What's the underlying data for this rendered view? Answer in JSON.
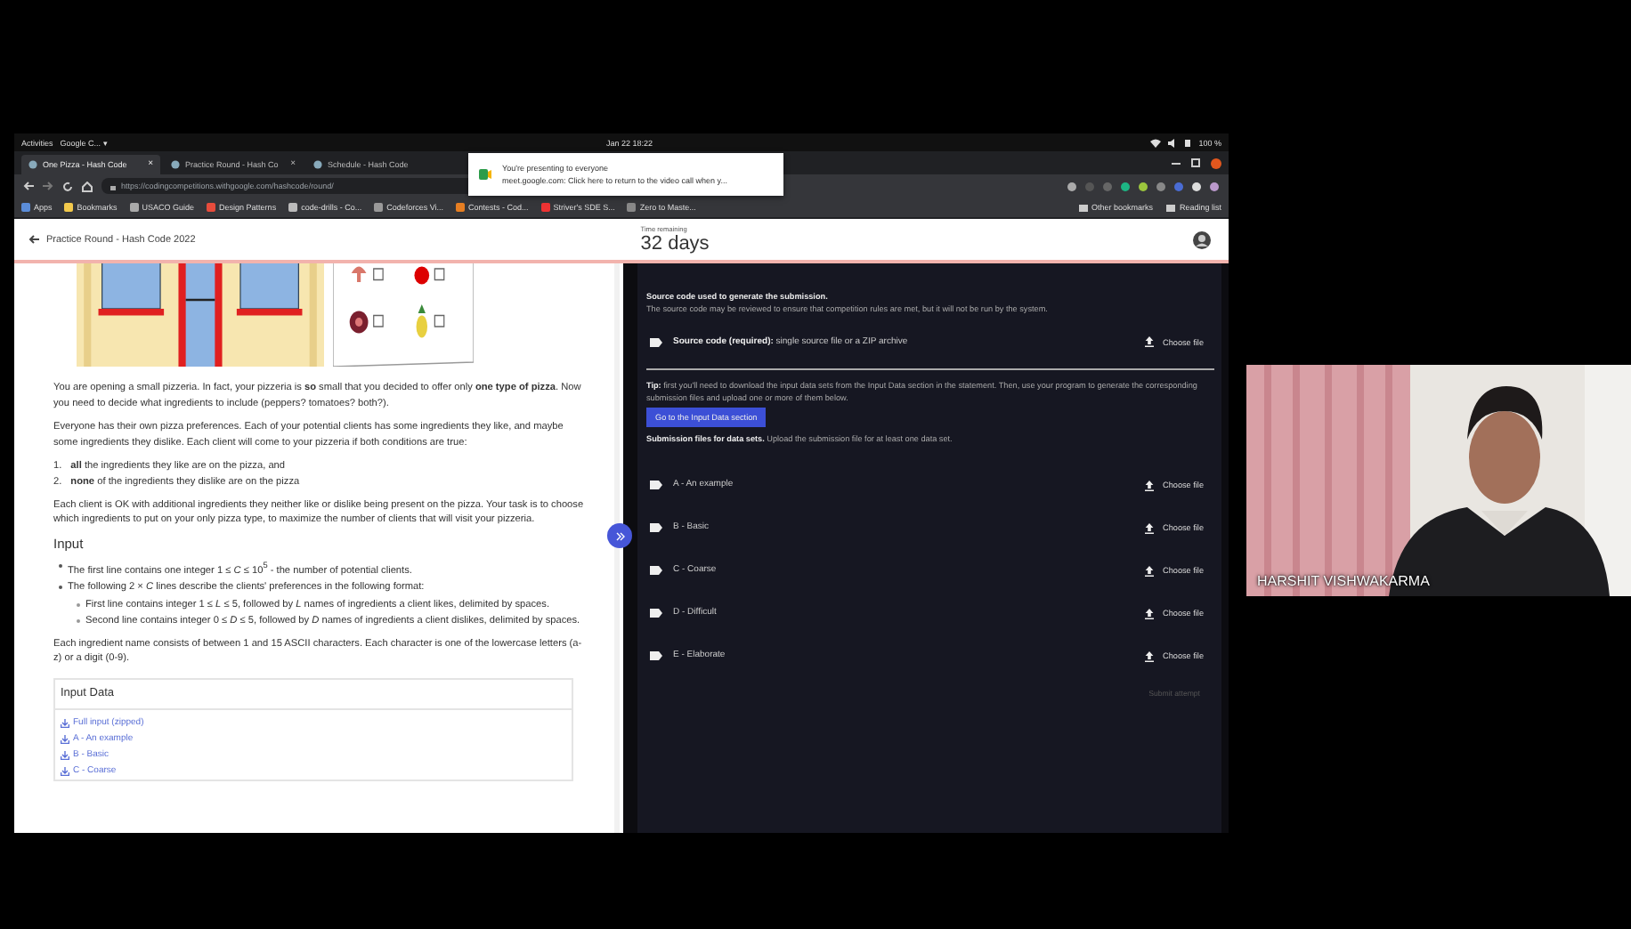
{
  "system_bar": {
    "activities": "Activities",
    "app_menu": "Google C... ▾",
    "clock": "Jan 22 18:22",
    "battery": "100 %"
  },
  "browser": {
    "tabs": [
      {
        "label": "One Pizza - Hash Code",
        "close": "×",
        "selected": true
      },
      {
        "label": "Practice Round - Hash Co",
        "close": "×",
        "selected": false
      },
      {
        "label": "Schedule - Hash Code",
        "selected": false
      }
    ],
    "url": "https://codingcompetitions.withgoogle.com/hashcode/round/",
    "bookmarks": [
      "Apps",
      "Bookmarks",
      "USACO Guide",
      "Design Patterns",
      "code-drills - Co...",
      "Codeforces Vi...",
      "Contests - Cod...",
      "Striver's SDE S...",
      "Zero to Maste..."
    ],
    "bookmarks_right": [
      "Other bookmarks",
      "Reading list"
    ]
  },
  "notification": {
    "title": "You're presenting to everyone",
    "body": "meet.google.com: Click here to return to the video call when y..."
  },
  "header": {
    "title": "Practice Round - Hash Code 2022",
    "time_label": "Time remaining",
    "time_value": "32 days"
  },
  "statement": {
    "blocks": [
      {
        "kind": "p",
        "text": "You are opening a small pizzeria. In fact, your pizzeria is **so** small that you decided to offer only **one type of pizza**. Now you need to decide what ingredients to include (peppers? tomatoes? both?)."
      },
      {
        "kind": "p",
        "text": "Everyone has their own pizza preferences. Each of your potential clients has some ingredients they like, and maybe some ingredients they dislike. Each client will come to your pizzeria if both conditions are true:"
      },
      {
        "kind": "ol",
        "items": [
          {
            "marker": "1.",
            "text": "**all** the ingredients they like are on the pizza, and"
          },
          {
            "marker": "2.",
            "text": "**none** of the ingredients they dislike are on the pizza"
          }
        ]
      },
      {
        "kind": "p",
        "text": "Each client is OK with additional ingredients they neither like or dislike being present on the pizza. Your task is to choose which ingredients to put on your only pizza type, to maximize the number of clients that will visit your pizzeria."
      },
      {
        "kind": "h",
        "text": "Input"
      },
      {
        "kind": "ul",
        "items": [
          {
            "text": "The first line contains one integer 1 ≤ *C* ≤ 10$^{5}$ - the number of potential clients."
          },
          {
            "text": "The following 2 × *C* lines describe the clients' preferences in the following format:",
            "children": [
              {
                "text": "First line contains integer 1 ≤ *L* ≤ 5, followed by *L* names of ingredients a client likes, delimited by spaces."
              },
              {
                "text": "Second line contains integer 0 ≤ *D* ≤ 5, followed by *D* names of ingredients a client dislikes, delimited by spaces."
              }
            ]
          }
        ]
      },
      {
        "kind": "p",
        "text": "Each ingredient name consists of between 1 and 15 ASCII characters. Each character is one of the lowercase letters (a-z) or a digit (0-9)."
      }
    ]
  },
  "input_data": {
    "title": "Input Data",
    "links": [
      "Full input (zipped)",
      "A - An example",
      "B - Basic",
      "C - Coarse"
    ]
  },
  "submission": {
    "source_title": "Source code used to generate the submission.",
    "source_note": "The source code may be reviewed to ensure that competition rules are met, but it will not be run by the system.",
    "source_row": {
      "label": "**Source code (required):** single source file or a ZIP archive",
      "action": "Choose file"
    },
    "tip": "**Tip:** first you'll need to download the input data sets from the Input Data section in the statement. Then, use your program to generate the corresponding submission files and upload one or more of them below.",
    "tip_button": "Go to the Input Data section",
    "datasets_note": "**Submission files for data sets.** Upload the submission file for at least one data set.",
    "datasets": [
      {
        "label": "A - An example",
        "action": "Choose file"
      },
      {
        "label": "B - Basic",
        "action": "Choose file"
      },
      {
        "label": "C - Coarse",
        "action": "Choose file"
      },
      {
        "label": "D - Difficult",
        "action": "Choose file"
      },
      {
        "label": "E - Elaborate",
        "action": "Choose file"
      }
    ],
    "submit": {
      "label": "Submit attempt",
      "disabled": true
    }
  },
  "participant": {
    "name": "HARSHIT VISHWAKARMA"
  }
}
